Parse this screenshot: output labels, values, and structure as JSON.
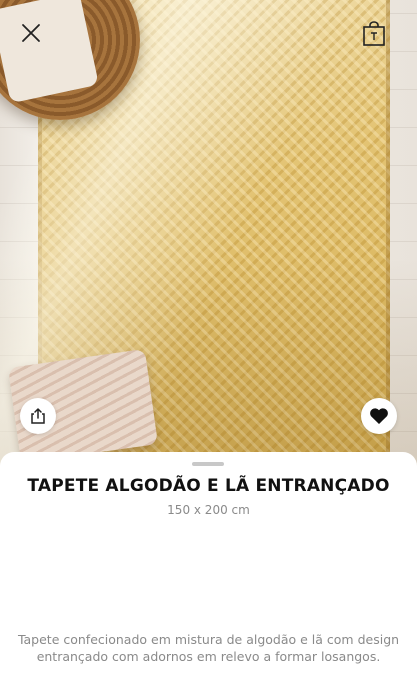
{
  "product": {
    "title": "TAPETE ALGODÃO E LÃ ENTRANÇADO",
    "size": "150 x 200 cm",
    "description": "Tapete confecionado em mistura de algodão e lã com design entrançado com adornos em relevo a formar losangos."
  },
  "icons": {
    "close": "close-icon",
    "bag": "shopping-bag-icon",
    "share": "share-icon",
    "favorite": "heart-icon"
  },
  "colors": {
    "title": "#111111",
    "secondary_text": "#8a8a8a",
    "rug": "#dcb75a"
  }
}
